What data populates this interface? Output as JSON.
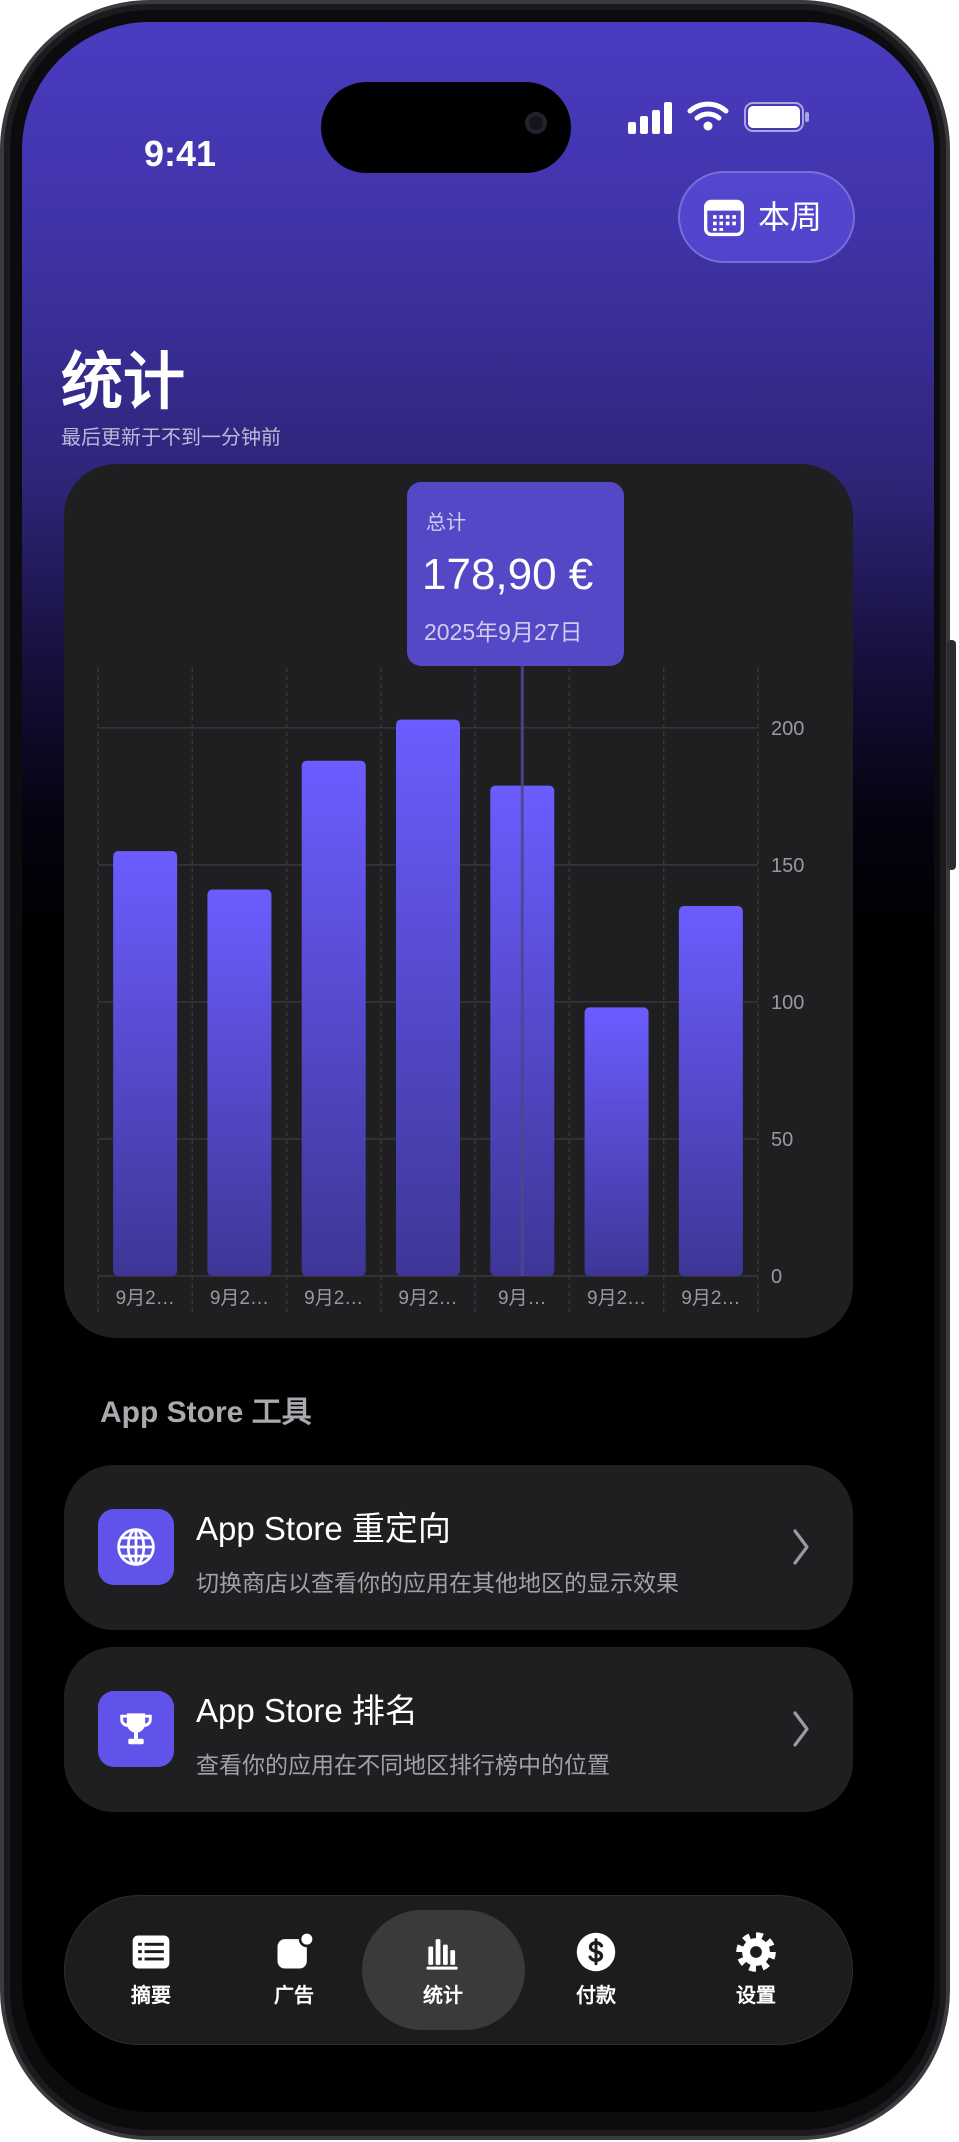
{
  "status_bar": {
    "time": "9:41",
    "icons": [
      "signal-icon",
      "wifi-icon",
      "battery-icon"
    ]
  },
  "header": {
    "period_button": {
      "label": "本周",
      "icon": "calendar-icon"
    },
    "title": "统计",
    "subtitle": "最后更新于不到一分钟前"
  },
  "tooltip": {
    "label": "总计",
    "value": "178,90 €",
    "date": "2025年9月27日"
  },
  "chart_data": {
    "type": "bar",
    "title": "",
    "xlabel": "",
    "ylabel": "",
    "categories": [
      "9月2…",
      "9月2…",
      "9月2…",
      "9月2…",
      "9月…",
      "9月2…",
      "9月2…"
    ],
    "values": [
      155,
      141,
      188,
      203,
      178.9,
      98,
      135
    ],
    "ylim": [
      0,
      220
    ],
    "yticks": [
      0,
      50,
      100,
      150,
      200
    ],
    "grid": true,
    "y_axis_side": "right",
    "selected_index": 4
  },
  "tools": {
    "section_title": "App Store 工具",
    "items": [
      {
        "title": "App Store 重定向",
        "subtitle": "切换商店以查看你的应用在其他地区的显示效果",
        "icon": "globe-icon"
      },
      {
        "title": "App Store 排名",
        "subtitle": "查看你的应用在不同地区排行榜中的位置",
        "icon": "trophy-icon"
      }
    ]
  },
  "tab_bar": {
    "selected_index": 2,
    "items": [
      {
        "label": "摘要",
        "icon": "list-icon"
      },
      {
        "label": "广告",
        "icon": "ad-icon"
      },
      {
        "label": "统计",
        "icon": "bar-chart-icon"
      },
      {
        "label": "付款",
        "icon": "dollar-icon"
      },
      {
        "label": "设置",
        "icon": "gear-icon"
      }
    ]
  },
  "colors": {
    "accent": "#6a5cff",
    "bar_top": "#6b5dff",
    "bar_bottom": "#3e3696",
    "selection_line": "#4b4790",
    "tooltip_bg": "#5448c6",
    "tool_icon_bg": "#5f53ea",
    "card_bg": "#1f1f21",
    "grid": "#38383b",
    "tick_label": "#9a9a9e"
  }
}
